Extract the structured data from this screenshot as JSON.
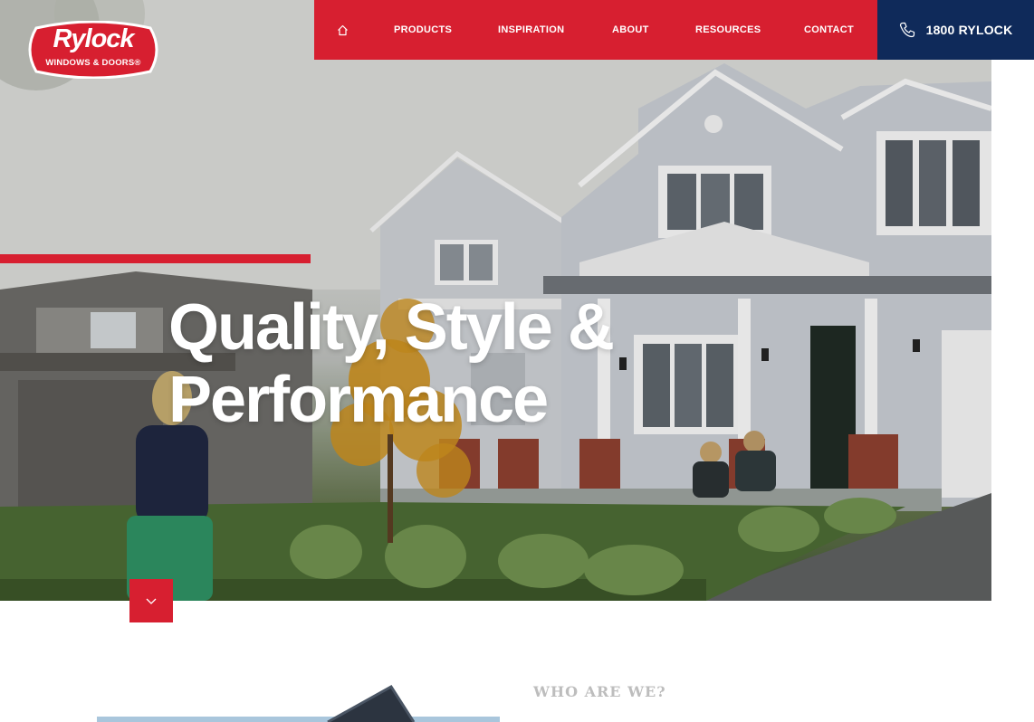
{
  "brand": {
    "name": "Rylock",
    "tagline": "WINDOWS & DOORS®",
    "colors": {
      "red": "#d71f30",
      "navy": "#0f2a5a"
    }
  },
  "nav": {
    "home_icon": "home-icon",
    "items": [
      {
        "label": "PRODUCTS"
      },
      {
        "label": "INSPIRATION"
      },
      {
        "label": "ABOUT"
      },
      {
        "label": "RESOURCES"
      },
      {
        "label": "CONTACT"
      }
    ],
    "phone": {
      "icon": "phone-icon",
      "label": "1800 RYLOCK"
    }
  },
  "hero": {
    "headline_line1": "Quality, Style &",
    "headline_line2": "Performance",
    "scroll_icon": "chevron-down-icon"
  },
  "about": {
    "heading": "WHO ARE WE?"
  }
}
